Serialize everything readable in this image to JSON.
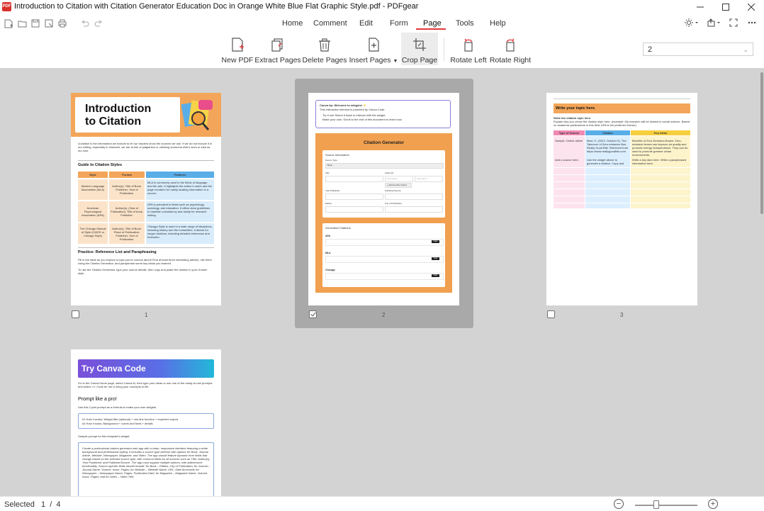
{
  "window": {
    "title": "Introduction to Citation with Citation Generator Education Doc in Orange White Blue Flat Graphic Style.pdf - PDFgear",
    "logo_text": "PDF"
  },
  "menu": {
    "tabs": [
      "Home",
      "Comment",
      "Edit",
      "Form",
      "Page",
      "Tools",
      "Help"
    ],
    "active_tab": "Page"
  },
  "ribbon": {
    "new_pdf": "New PDF",
    "extract_pages": "Extract Pages",
    "delete_pages": "Delete Pages",
    "insert_pages": "Insert Pages",
    "crop_page": "Crop Page",
    "rotate_left": "Rotate Left",
    "rotate_right": "Rotate Right"
  },
  "page_select": {
    "value": "2"
  },
  "pages": [
    {
      "number": "1",
      "selected": false,
      "heading_line1": "Introduction",
      "heading_line2": "to Citation",
      "intro": "A citation is the information we include to let our readers know the sources we use. If we do not include it in our writing, especially in research, we are at risk of plagiarism or claiming someone else's work or idea as our own.",
      "guide_title": "Guide to Citation Styles",
      "table_headers": [
        "Style",
        "Format",
        "Features"
      ],
      "table_rows": [
        [
          "Modern Language Association (MLA)",
          "Author(s). Title of Book. Publisher, Year of Publication.",
          "MLA is commonly used in the fields of language and the arts. It highlights the author's name and the page numbers for easily locating information in a source."
        ],
        [
          "American Psychological Association (APA)",
          "Author(s). (Year of Publication). Title of book. Publisher.",
          "APA is prevalent in fields such as psychology, sociology, and education. It offers clear guidelines to maintain consistency and clarity for research writing."
        ],
        [
          "The Chicago Manual of Style (CMOS or Chicago Style)",
          "Author(s). Title of Book. Place of Publication: Publisher, Year of Publication.",
          "Chicago Style is used in a wide range of disciplines, including history and the humanities. It allows for longer citations, including detailed references and footnotes."
        ]
      ],
      "practice_title": "Practice: Reference List and Paraphrasing",
      "practice_p1": "Fill in the table as you explore a topic you're curious about! Find at least three interesting articles, cite them using the Citation Generator, and paraphrase some key ideas you learned.",
      "practice_p2": "To use the Citation Generator, type your source details, then copy and paste the citation in your chosen style."
    },
    {
      "number": "2",
      "selected": true,
      "tip_title": "Canva tip: Welcome to widgets! ⚡",
      "tip_sub": "This interactive element is powered by Canva Code.",
      "tip_b1": "Try it out! Select it twice to interact with the widget.",
      "tip_b2": "Make your own. Scroll to the end of this document to learn how.",
      "gen_title": "Citation Generator",
      "source_info": "Source Information",
      "source_type": "Source Type",
      "source_type_val": "Book",
      "f_title": "Title",
      "f_authors": "Author(s)",
      "ph_first": "First Name",
      "ph_last": "Last Name",
      "add_author": "+ Add Another Author",
      "f_year": "Year Published",
      "f_publisher": "Publisher/Source",
      "f_edition": "Edition",
      "f_city": "City of Publication",
      "generated": "Generated Citations",
      "apa": "APA",
      "mla": "MLA",
      "chicago": "Chicago",
      "copy": "Copy"
    },
    {
      "number": "3",
      "selected": false,
      "topic_title": "Write your topic here.",
      "topic_p1": "Write the citation style here.",
      "topic_p2": "Explain why you chose the citation style here. (example: My research will be related to social science. Based on academic publications in this field, APA is the preferred format.)",
      "headers": [
        "Type of Source",
        "Citation",
        "Key Ideas"
      ],
      "row1": [
        "Sample: Online article",
        "Best, H. (2023, October 5). The Takeover of Zero-emission Bus. Really Good Bits. Retrieved from https://www.reallygoodbits.com",
        "Benefits of Zero-Emission Buses: Zero-emission buses can improve air quality and promote energy independence. They can be used to promote greener urban environments."
      ],
      "row2": [
        "Add a source here.",
        "Use the widget above to generate a citation. Copy and paste it here.",
        "Write a key idea here. Write a paraphrased information here."
      ]
    },
    {
      "number": "4",
      "selected": false,
      "banner": "Try Canva Code",
      "p1": "Go to the Canva Home page, select Canva AI, then type your ideas or use one of the ready-to-use prompts and select </> Code for me to bring your concepts to life.",
      "prompt_title": "Prompt like a pro!",
      "p2": "Use this 2-part prompt as a formula to make your own widgets.",
      "box1_l1": "#1 How it works: Widget title (optional) + one-line function + expected output",
      "box1_l2": "#2 How it looks: Background + colors and fonts + details",
      "sample": "Sample prompt for this template's widget:",
      "box2": "Create a professional citation generator web app with a clean, responsive interface featuring a white background and professional styling. It includes a source type selector with options for Book, Journal Article, Website, Newspaper, Magazine, and Video. The app should feature dynamic form fields that change based on the selected source type, with common fields for all sources such as Title, Author(s), Year Published, and Publisher/Source. The app must support multiple authors, with add/remove functionality. Source-specific fields should include: for Book – Edition, City of Publication; for Journal – Journal Name, Volume, Issue, Pages; for Website – Website Name, URL, Date Accessed; for Newspaper – Newspaper Name, Pages, Publication Date; for Magazine – Magazine Name, Volume, Issue, Pages; and for Video – Video Title,"
    }
  ],
  "status": {
    "selected_label": "Selected",
    "current": "1",
    "separator": "/",
    "total": "4"
  },
  "zoom": {
    "minus": "−",
    "plus": "+"
  },
  "colors": {
    "accent": "#e0393c",
    "orange": "#f1a04f",
    "header_orange": "#f3a65a",
    "blue": "#5aaee8",
    "purple_banner": "#7a4fd9",
    "canvas": "#d3d3d3"
  }
}
